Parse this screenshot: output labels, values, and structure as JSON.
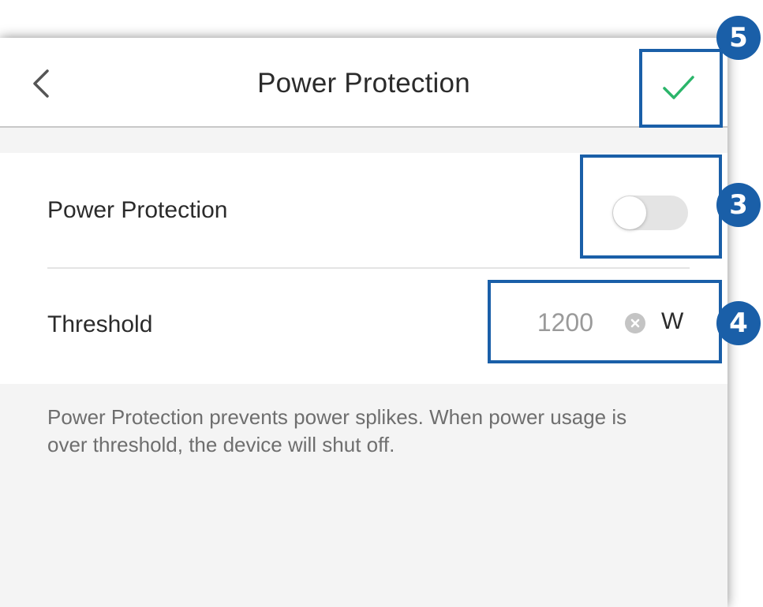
{
  "header": {
    "title": "Power Protection",
    "back_icon": "chevron-left-icon",
    "confirm_icon": "checkmark-icon",
    "accent_color": "#2bb56a"
  },
  "settings": {
    "power_protection": {
      "label": "Power Protection",
      "enabled": false
    },
    "threshold": {
      "label": "Threshold",
      "value": "1200",
      "unit": "W",
      "clear_icon": "clear-circle-icon"
    }
  },
  "footnote": "Power Protection prevents power splikes. When power usage is over threshold, the device will shut off.",
  "callouts": [
    {
      "number": "5",
      "target": "confirm-button"
    },
    {
      "number": "3",
      "target": "power-protection-toggle"
    },
    {
      "number": "4",
      "target": "threshold-field"
    }
  ],
  "colors": {
    "callout": "#1a5fa8",
    "toggle_off": "#e4e4e4",
    "background": "#f4f4f4"
  }
}
